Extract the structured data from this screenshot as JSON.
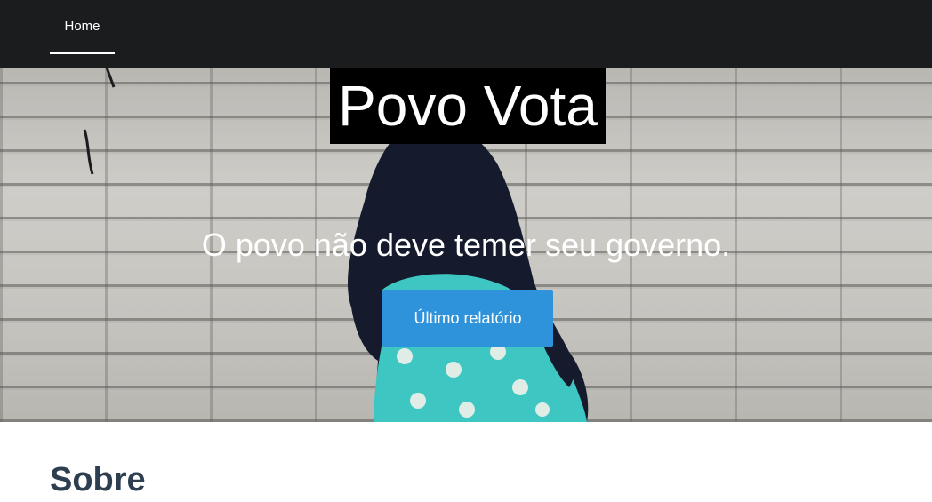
{
  "nav": {
    "items": [
      {
        "label": "Home",
        "active": true
      }
    ]
  },
  "hero": {
    "title": "Povo Vota",
    "subtitle": "O povo não deve temer seu governo.",
    "cta_label": "Último relatório",
    "background_image": "graffiti-girl-brick-wall"
  },
  "sections": {
    "about_title": "Sobre"
  },
  "colors": {
    "navbar": "#1b1c1e",
    "accent": "#2f93dc",
    "heading": "#2c3e50"
  }
}
